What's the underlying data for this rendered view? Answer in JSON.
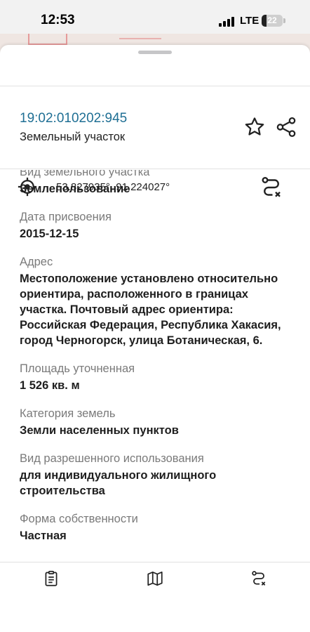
{
  "status_bar": {
    "time": "12:53",
    "network": "LTE",
    "battery": "22",
    "battery_level_percent": 22
  },
  "parcel": {
    "cadastral_number": "19:02:010202:945",
    "type": "Земельный участок",
    "coordinates": "53.827935°, 91.224027°"
  },
  "fields": [
    {
      "label": "Вид земельного участка",
      "value": "Землепользование"
    },
    {
      "label": "Дата присвоения",
      "value": "2015-12-15"
    },
    {
      "label": "Адрес",
      "value": "Местоположение установлено относительно ориентира, расположенного в границах участка. Почтовый адрес ориентира: Российская Федерация, Республика Хакасия, город Черногорск, улица Ботаническая, 6."
    },
    {
      "label": "Площадь уточненная",
      "value": "1 526 кв. м"
    },
    {
      "label": "Категория земель",
      "value": "Земли населенных пунктов"
    },
    {
      "label": "Вид разрешенного использования",
      "value": "для индивидуального жилищного строительства"
    },
    {
      "label": "Форма собственности",
      "value": "Частная"
    }
  ],
  "icons": {
    "favorite": "star-icon",
    "share": "share-icon",
    "locate": "crosshair-icon",
    "route": "route-icon",
    "tab_details": "clipboard-icon",
    "tab_map": "map-icon",
    "tab_route": "route-icon"
  },
  "colors": {
    "accent": "#1f6f94",
    "label": "#7a7a7a",
    "text": "#1e1e1e"
  }
}
